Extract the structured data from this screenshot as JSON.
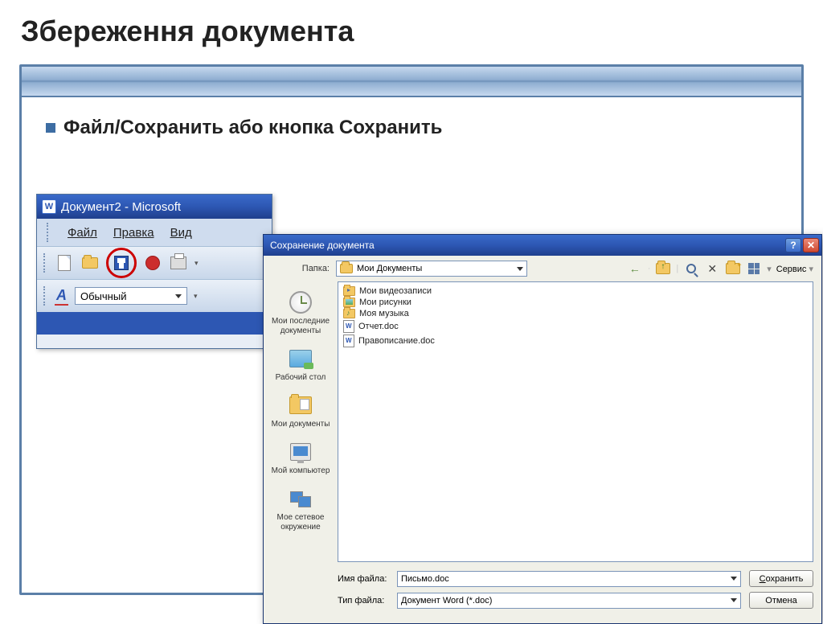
{
  "slide": {
    "title": "Збереження документа",
    "bullet": "Файл/Сохранить  або кнопка Сохранить"
  },
  "word": {
    "title": "Документ2 - Microsoft",
    "menu": {
      "file": "Файл",
      "edit": "Правка",
      "view": "Вид"
    },
    "style": "Обычный"
  },
  "dlg": {
    "title": "Сохранение документа",
    "folder_label": "Папка:",
    "folder_value": "Мои Документы",
    "service": "Сервис",
    "sidebar": {
      "recent": "Мои последние документы",
      "desktop": "Рабочий стол",
      "mydocs": "Мои документы",
      "mycomp": "Мой компьютер",
      "mynet": "Мое сетевое окружение"
    },
    "files": [
      {
        "type": "folder-vid",
        "name": "Мои видеозаписи"
      },
      {
        "type": "folder-pic",
        "name": "Мои рисунки"
      },
      {
        "type": "folder-music",
        "name": "Моя музыка"
      },
      {
        "type": "doc",
        "name": "Отчет.doc"
      },
      {
        "type": "doc",
        "name": "Правописание.doc"
      }
    ],
    "filename_label": "Имя файла:",
    "filename_value": "Письмо.doc",
    "filetype_label": "Тип файла:",
    "filetype_value": "Документ Word (*.doc)",
    "save_btn": "Сохранить",
    "cancel_btn": "Отмена"
  }
}
